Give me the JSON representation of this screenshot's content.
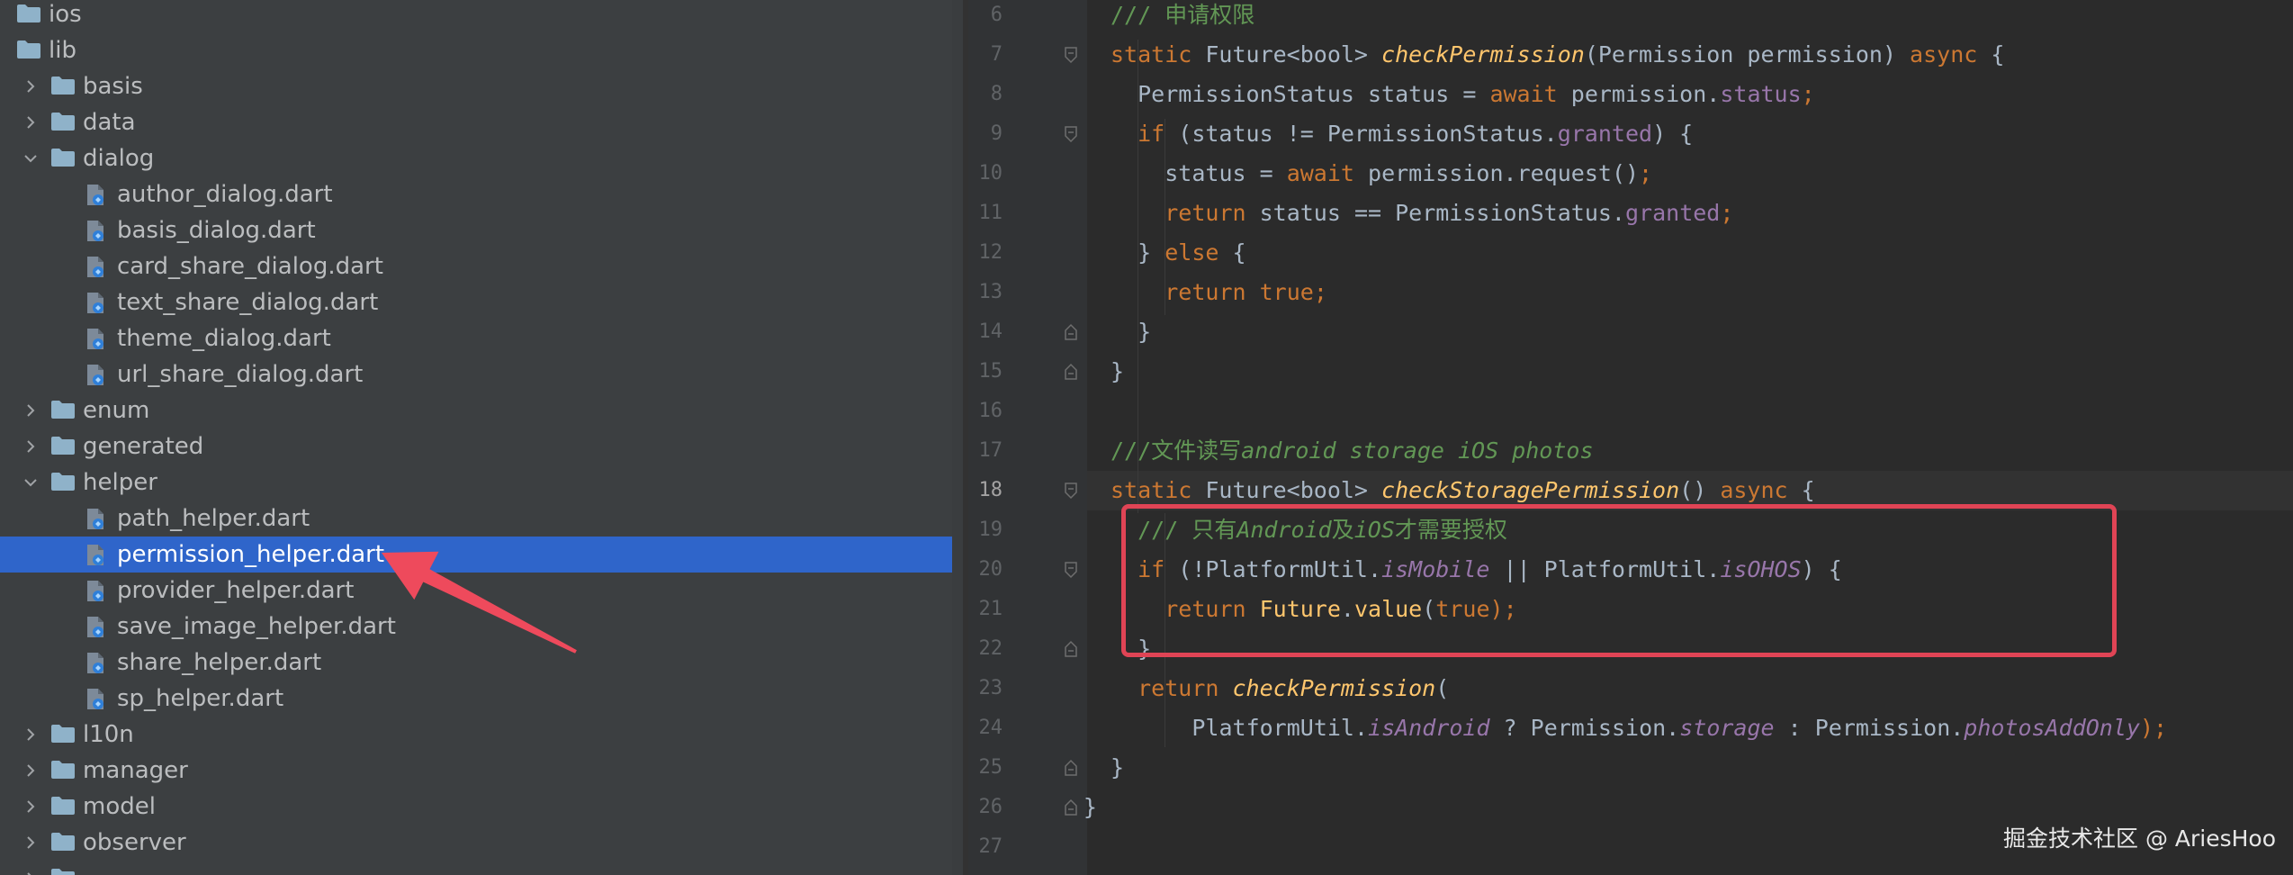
{
  "project_tree": {
    "items": [
      {
        "label": "ios",
        "kind": "folder",
        "expanded": null,
        "depth": 0
      },
      {
        "label": "lib",
        "kind": "folder",
        "expanded": null,
        "depth": 0
      },
      {
        "label": "basis",
        "kind": "folder",
        "expanded": false,
        "depth": 1
      },
      {
        "label": "data",
        "kind": "folder",
        "expanded": false,
        "depth": 1
      },
      {
        "label": "dialog",
        "kind": "folder",
        "expanded": true,
        "depth": 1
      },
      {
        "label": "author_dialog.dart",
        "kind": "dart",
        "depth": 2
      },
      {
        "label": "basis_dialog.dart",
        "kind": "dart",
        "depth": 2
      },
      {
        "label": "card_share_dialog.dart",
        "kind": "dart",
        "depth": 2
      },
      {
        "label": "text_share_dialog.dart",
        "kind": "dart",
        "depth": 2
      },
      {
        "label": "theme_dialog.dart",
        "kind": "dart",
        "depth": 2
      },
      {
        "label": "url_share_dialog.dart",
        "kind": "dart",
        "depth": 2
      },
      {
        "label": "enum",
        "kind": "folder",
        "expanded": false,
        "depth": 1
      },
      {
        "label": "generated",
        "kind": "folder",
        "expanded": false,
        "depth": 1
      },
      {
        "label": "helper",
        "kind": "folder",
        "expanded": true,
        "depth": 1
      },
      {
        "label": "path_helper.dart",
        "kind": "dart",
        "depth": 2
      },
      {
        "label": "permission_helper.dart",
        "kind": "dart",
        "depth": 2,
        "selected": true
      },
      {
        "label": "provider_helper.dart",
        "kind": "dart",
        "depth": 2
      },
      {
        "label": "save_image_helper.dart",
        "kind": "dart",
        "depth": 2
      },
      {
        "label": "share_helper.dart",
        "kind": "dart",
        "depth": 2
      },
      {
        "label": "sp_helper.dart",
        "kind": "dart",
        "depth": 2
      },
      {
        "label": "l10n",
        "kind": "folder",
        "expanded": false,
        "depth": 1
      },
      {
        "label": "manager",
        "kind": "folder",
        "expanded": false,
        "depth": 1
      },
      {
        "label": "model",
        "kind": "folder",
        "expanded": false,
        "depth": 1
      },
      {
        "label": "observer",
        "kind": "folder",
        "expanded": false,
        "depth": 1
      },
      {
        "label": "",
        "kind": "folder",
        "expanded": false,
        "depth": 1
      }
    ]
  },
  "editor": {
    "current_line": 18,
    "lines": [
      {
        "num": "6",
        "tokens": [
          {
            "t": "/// 申请权限",
            "c": "doc"
          }
        ]
      },
      {
        "num": "7",
        "tokens": [
          {
            "t": "static ",
            "c": "kw"
          },
          {
            "t": "Future<bool> ",
            "c": "plain"
          },
          {
            "t": "checkPermission",
            "c": "fn"
          },
          {
            "t": "(Permission permission) ",
            "c": "plain"
          },
          {
            "t": "async ",
            "c": "kw"
          },
          {
            "t": "{",
            "c": "plain"
          }
        ]
      },
      {
        "num": "8",
        "tokens": [
          {
            "t": "PermissionStatus status = ",
            "c": "plain"
          },
          {
            "t": "await ",
            "c": "kw"
          },
          {
            "t": "permission.",
            "c": "plain"
          },
          {
            "t": "status",
            "c": "field"
          },
          {
            "t": ";",
            "c": "kw"
          }
        ]
      },
      {
        "num": "9",
        "tokens": [
          {
            "t": "if ",
            "c": "kw"
          },
          {
            "t": "(status != PermissionStatus.",
            "c": "plain"
          },
          {
            "t": "granted",
            "c": "field"
          },
          {
            "t": ") {",
            "c": "plain"
          }
        ]
      },
      {
        "num": "10",
        "tokens": [
          {
            "t": "status = ",
            "c": "plain"
          },
          {
            "t": "await ",
            "c": "kw"
          },
          {
            "t": "permission.request()",
            "c": "plain"
          },
          {
            "t": ";",
            "c": "kw"
          }
        ]
      },
      {
        "num": "11",
        "tokens": [
          {
            "t": "return ",
            "c": "kw"
          },
          {
            "t": "status == PermissionStatus.",
            "c": "plain"
          },
          {
            "t": "granted",
            "c": "field"
          },
          {
            "t": ";",
            "c": "kw"
          }
        ]
      },
      {
        "num": "12",
        "tokens": [
          {
            "t": "} ",
            "c": "plain"
          },
          {
            "t": "else ",
            "c": "kw"
          },
          {
            "t": "{",
            "c": "plain"
          }
        ]
      },
      {
        "num": "13",
        "tokens": [
          {
            "t": "return ",
            "c": "kw"
          },
          {
            "t": "true",
            "c": "kw"
          },
          {
            "t": ";",
            "c": "kw"
          }
        ]
      },
      {
        "num": "14",
        "tokens": [
          {
            "t": "}",
            "c": "plain"
          }
        ]
      },
      {
        "num": "15",
        "tokens": [
          {
            "t": "}",
            "c": "plain"
          }
        ]
      },
      {
        "num": "16",
        "tokens": []
      },
      {
        "num": "17",
        "tokens": [
          {
            "t": "///文件读写",
            "c": "doc"
          },
          {
            "t": "android storage iOS photos",
            "c": "doc-it"
          }
        ]
      },
      {
        "num": "18",
        "tokens": [
          {
            "t": "static ",
            "c": "kw"
          },
          {
            "t": "Future<bool> ",
            "c": "plain"
          },
          {
            "t": "checkStoragePermission",
            "c": "fn"
          },
          {
            "t": "() ",
            "c": "plain"
          },
          {
            "t": "async ",
            "c": "kw"
          },
          {
            "t": "{",
            "c": "plain"
          }
        ]
      },
      {
        "num": "19",
        "tokens": [
          {
            "t": "/// 只有",
            "c": "doc"
          },
          {
            "t": "Android",
            "c": "doc-it"
          },
          {
            "t": "及",
            "c": "doc"
          },
          {
            "t": "iOS",
            "c": "doc-it"
          },
          {
            "t": "才需要授权",
            "c": "doc"
          }
        ]
      },
      {
        "num": "20",
        "tokens": [
          {
            "t": "if ",
            "c": "kw"
          },
          {
            "t": "(!PlatformUtil.",
            "c": "plain"
          },
          {
            "t": "isMobile",
            "c": "static"
          },
          {
            "t": " || PlatformUtil.",
            "c": "plain"
          },
          {
            "t": "isOHOS",
            "c": "static"
          },
          {
            "t": ") {",
            "c": "plain"
          }
        ]
      },
      {
        "num": "21",
        "tokens": [
          {
            "t": "return ",
            "c": "kw"
          },
          {
            "t": "Future",
            "c": "cls"
          },
          {
            "t": ".",
            "c": "plain"
          },
          {
            "t": "value",
            "c": "cls"
          },
          {
            "t": "(",
            "c": "plain"
          },
          {
            "t": "true",
            "c": "kw"
          },
          {
            "t": ");",
            "c": "kw"
          }
        ]
      },
      {
        "num": "22",
        "tokens": [
          {
            "t": "}",
            "c": "plain"
          }
        ]
      },
      {
        "num": "23",
        "tokens": [
          {
            "t": "return ",
            "c": "kw"
          },
          {
            "t": "checkPermission",
            "c": "fn"
          },
          {
            "t": "(",
            "c": "plain"
          }
        ]
      },
      {
        "num": "24",
        "tokens": [
          {
            "t": "PlatformUtil.",
            "c": "plain"
          },
          {
            "t": "isAndroid",
            "c": "static"
          },
          {
            "t": " ? Permission.",
            "c": "plain"
          },
          {
            "t": "storage",
            "c": "static"
          },
          {
            "t": " : Permission.",
            "c": "plain"
          },
          {
            "t": "photosAddOnly",
            "c": "static"
          },
          {
            "t": ");",
            "c": "kw"
          }
        ]
      },
      {
        "num": "25",
        "tokens": [
          {
            "t": "}",
            "c": "plain"
          }
        ]
      },
      {
        "num": "26",
        "tokens": [
          {
            "t": "}",
            "c": "plain"
          }
        ]
      },
      {
        "num": "27",
        "tokens": []
      }
    ]
  },
  "annotation": {
    "box_color": "#e04455",
    "arrow_color": "#ee4a5c"
  },
  "watermark": {
    "text": "掘金技术社区 @ AriesHoo"
  },
  "colors": {
    "tree_bg": "#3c3f41",
    "selection": "#2f65ca",
    "editor_bg": "#2b2b2b",
    "gutter_bg": "#313335",
    "keyword": "#cc7832",
    "function": "#ffc66d",
    "field": "#9876aa",
    "doc_comment": "#629755",
    "text": "#a9b7c6",
    "folder_icon": "#8fb2c9",
    "dart_file_icon": "#7d8a99"
  }
}
